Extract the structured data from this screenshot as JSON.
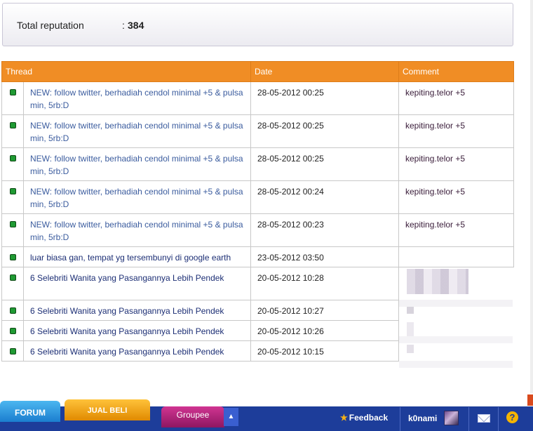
{
  "reputation": {
    "label": "Total reputation",
    "separator": ":",
    "value": "384"
  },
  "table": {
    "headers": [
      "Thread",
      "Date",
      "Comment"
    ],
    "rows": [
      {
        "thread": "NEW: follow twitter, berhadiah cendol minimal +5 & pulsa min, 5rb:D",
        "date": "28-05-2012 00:25",
        "comment": "kepiting.telor +5"
      },
      {
        "thread": "NEW: follow twitter, berhadiah cendol minimal +5 & pulsa min, 5rb:D",
        "date": "28-05-2012 00:25",
        "comment": "kepiting.telor +5"
      },
      {
        "thread": "NEW: follow twitter, berhadiah cendol minimal +5 & pulsa min, 5rb:D",
        "date": "28-05-2012 00:25",
        "comment": "kepiting.telor +5"
      },
      {
        "thread": "NEW: follow twitter, berhadiah cendol minimal +5 & pulsa min, 5rb:D",
        "date": "28-05-2012 00:24",
        "comment": "kepiting.telor +5"
      },
      {
        "thread": "NEW: follow twitter, berhadiah cendol minimal +5 & pulsa min, 5rb:D",
        "date": "28-05-2012 00:23",
        "comment": "kepiting.telor +5"
      },
      {
        "thread": "luar biasa gan, tempat yg tersembunyi di google earth",
        "date": "23-05-2012 03:50",
        "comment": ""
      },
      {
        "thread": "6 Selebriti Wanita yang Pasangannya Lebih Pendek",
        "date": "20-05-2012 10:28",
        "comment": ""
      },
      {
        "thread": "6 Selebriti Wanita yang Pasangannya Lebih Pendek",
        "date": "20-05-2012 10:27",
        "comment": ""
      },
      {
        "thread": "6 Selebriti Wanita yang Pasangannya Lebih Pendek",
        "date": "20-05-2012 10:26",
        "comment": ""
      },
      {
        "thread": "6 Selebriti Wanita yang Pasangannya Lebih Pendek",
        "date": "20-05-2012 10:15",
        "comment": ""
      }
    ]
  },
  "bottombar": {
    "forum": "FORUM",
    "jual_beli": "JUAL BELI",
    "groupee": "Groupee",
    "arrow": "▲",
    "feedback": "Feedback",
    "username": "k0nami",
    "help": "?"
  },
  "colors": {
    "header_orange": "#f08d25",
    "link_blue": "#3b5c9e",
    "bar_blue": "#1d3d9a",
    "status_green": "#1f9a33"
  },
  "icons": [
    "status-dot-icon",
    "star-icon",
    "avatar",
    "mail-icon",
    "help-icon",
    "arrow-up-icon"
  ]
}
